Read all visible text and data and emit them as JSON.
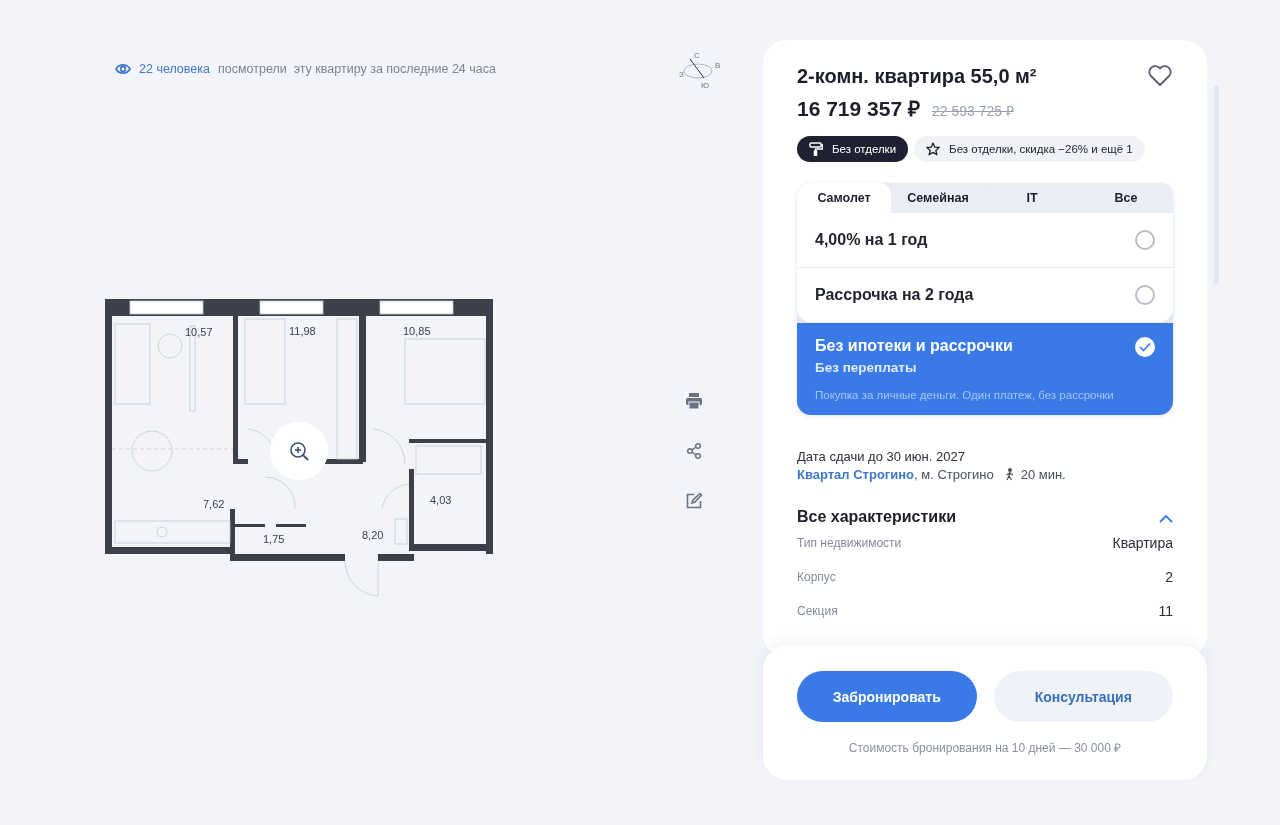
{
  "views": {
    "count": "22 человека",
    "text": "посмотрели  эту квартиру за последние 24 часа"
  },
  "compass": {
    "north": "С",
    "east": "В",
    "south": "Ю",
    "west": "З"
  },
  "floor_plan": {
    "rooms": [
      {
        "area": "10,57"
      },
      {
        "area": "11,98"
      },
      {
        "area": "10,85"
      },
      {
        "area": "7,62"
      },
      {
        "area": "1,75"
      },
      {
        "area": "8,20"
      },
      {
        "area": "4,03"
      }
    ]
  },
  "actions": [
    {
      "kind": "print"
    },
    {
      "kind": "share"
    },
    {
      "kind": "edit"
    }
  ],
  "listing": {
    "title": "2-комн. квартира 55,0 м²",
    "favorite": false,
    "price": "16 719 357 ₽",
    "old_price": "22 593 725 ₽",
    "chips": [
      {
        "kind": "finish",
        "label": "Без отделки",
        "selected": true
      },
      {
        "kind": "promo",
        "label": "Без отделки, скидка −26% и ещё 1",
        "selected": false
      }
    ]
  },
  "payment": {
    "tabs": [
      {
        "label": "Самолет",
        "selected": true
      },
      {
        "label": "Семейная",
        "selected": false
      },
      {
        "label": "IT",
        "selected": false
      },
      {
        "label": "Все",
        "selected": false
      }
    ],
    "options": [
      {
        "title": "4,00% на 1 год",
        "selected": false
      },
      {
        "title": "Рассрочка на 2 года",
        "selected": false
      },
      {
        "title": "Без ипотеки и рассрочки",
        "subtitle": "Без переплаты",
        "note": "Покупка за личные деньги. Один платеж, без рассрочки",
        "selected": true
      }
    ]
  },
  "delivery": "Дата сдачи до 30 июн. 2027",
  "location": {
    "complex": "Квартал Строгино",
    "metro": ", м. Строгино",
    "walk": "20 мин."
  },
  "specs": {
    "title": "Все характеристики",
    "expanded": true,
    "rows": [
      {
        "label": "Тип недвижимости",
        "value": "Квартира"
      },
      {
        "label": "Корпус",
        "value": "2"
      },
      {
        "label": "Секция",
        "value": "11"
      }
    ]
  },
  "booking": {
    "buttons": [
      {
        "kind": "primary",
        "label": "Забронировать"
      },
      {
        "kind": "secondary",
        "label": "Консультация"
      }
    ],
    "note": "Стоимость бронирования на 10 дней — 30 000 ₽"
  }
}
